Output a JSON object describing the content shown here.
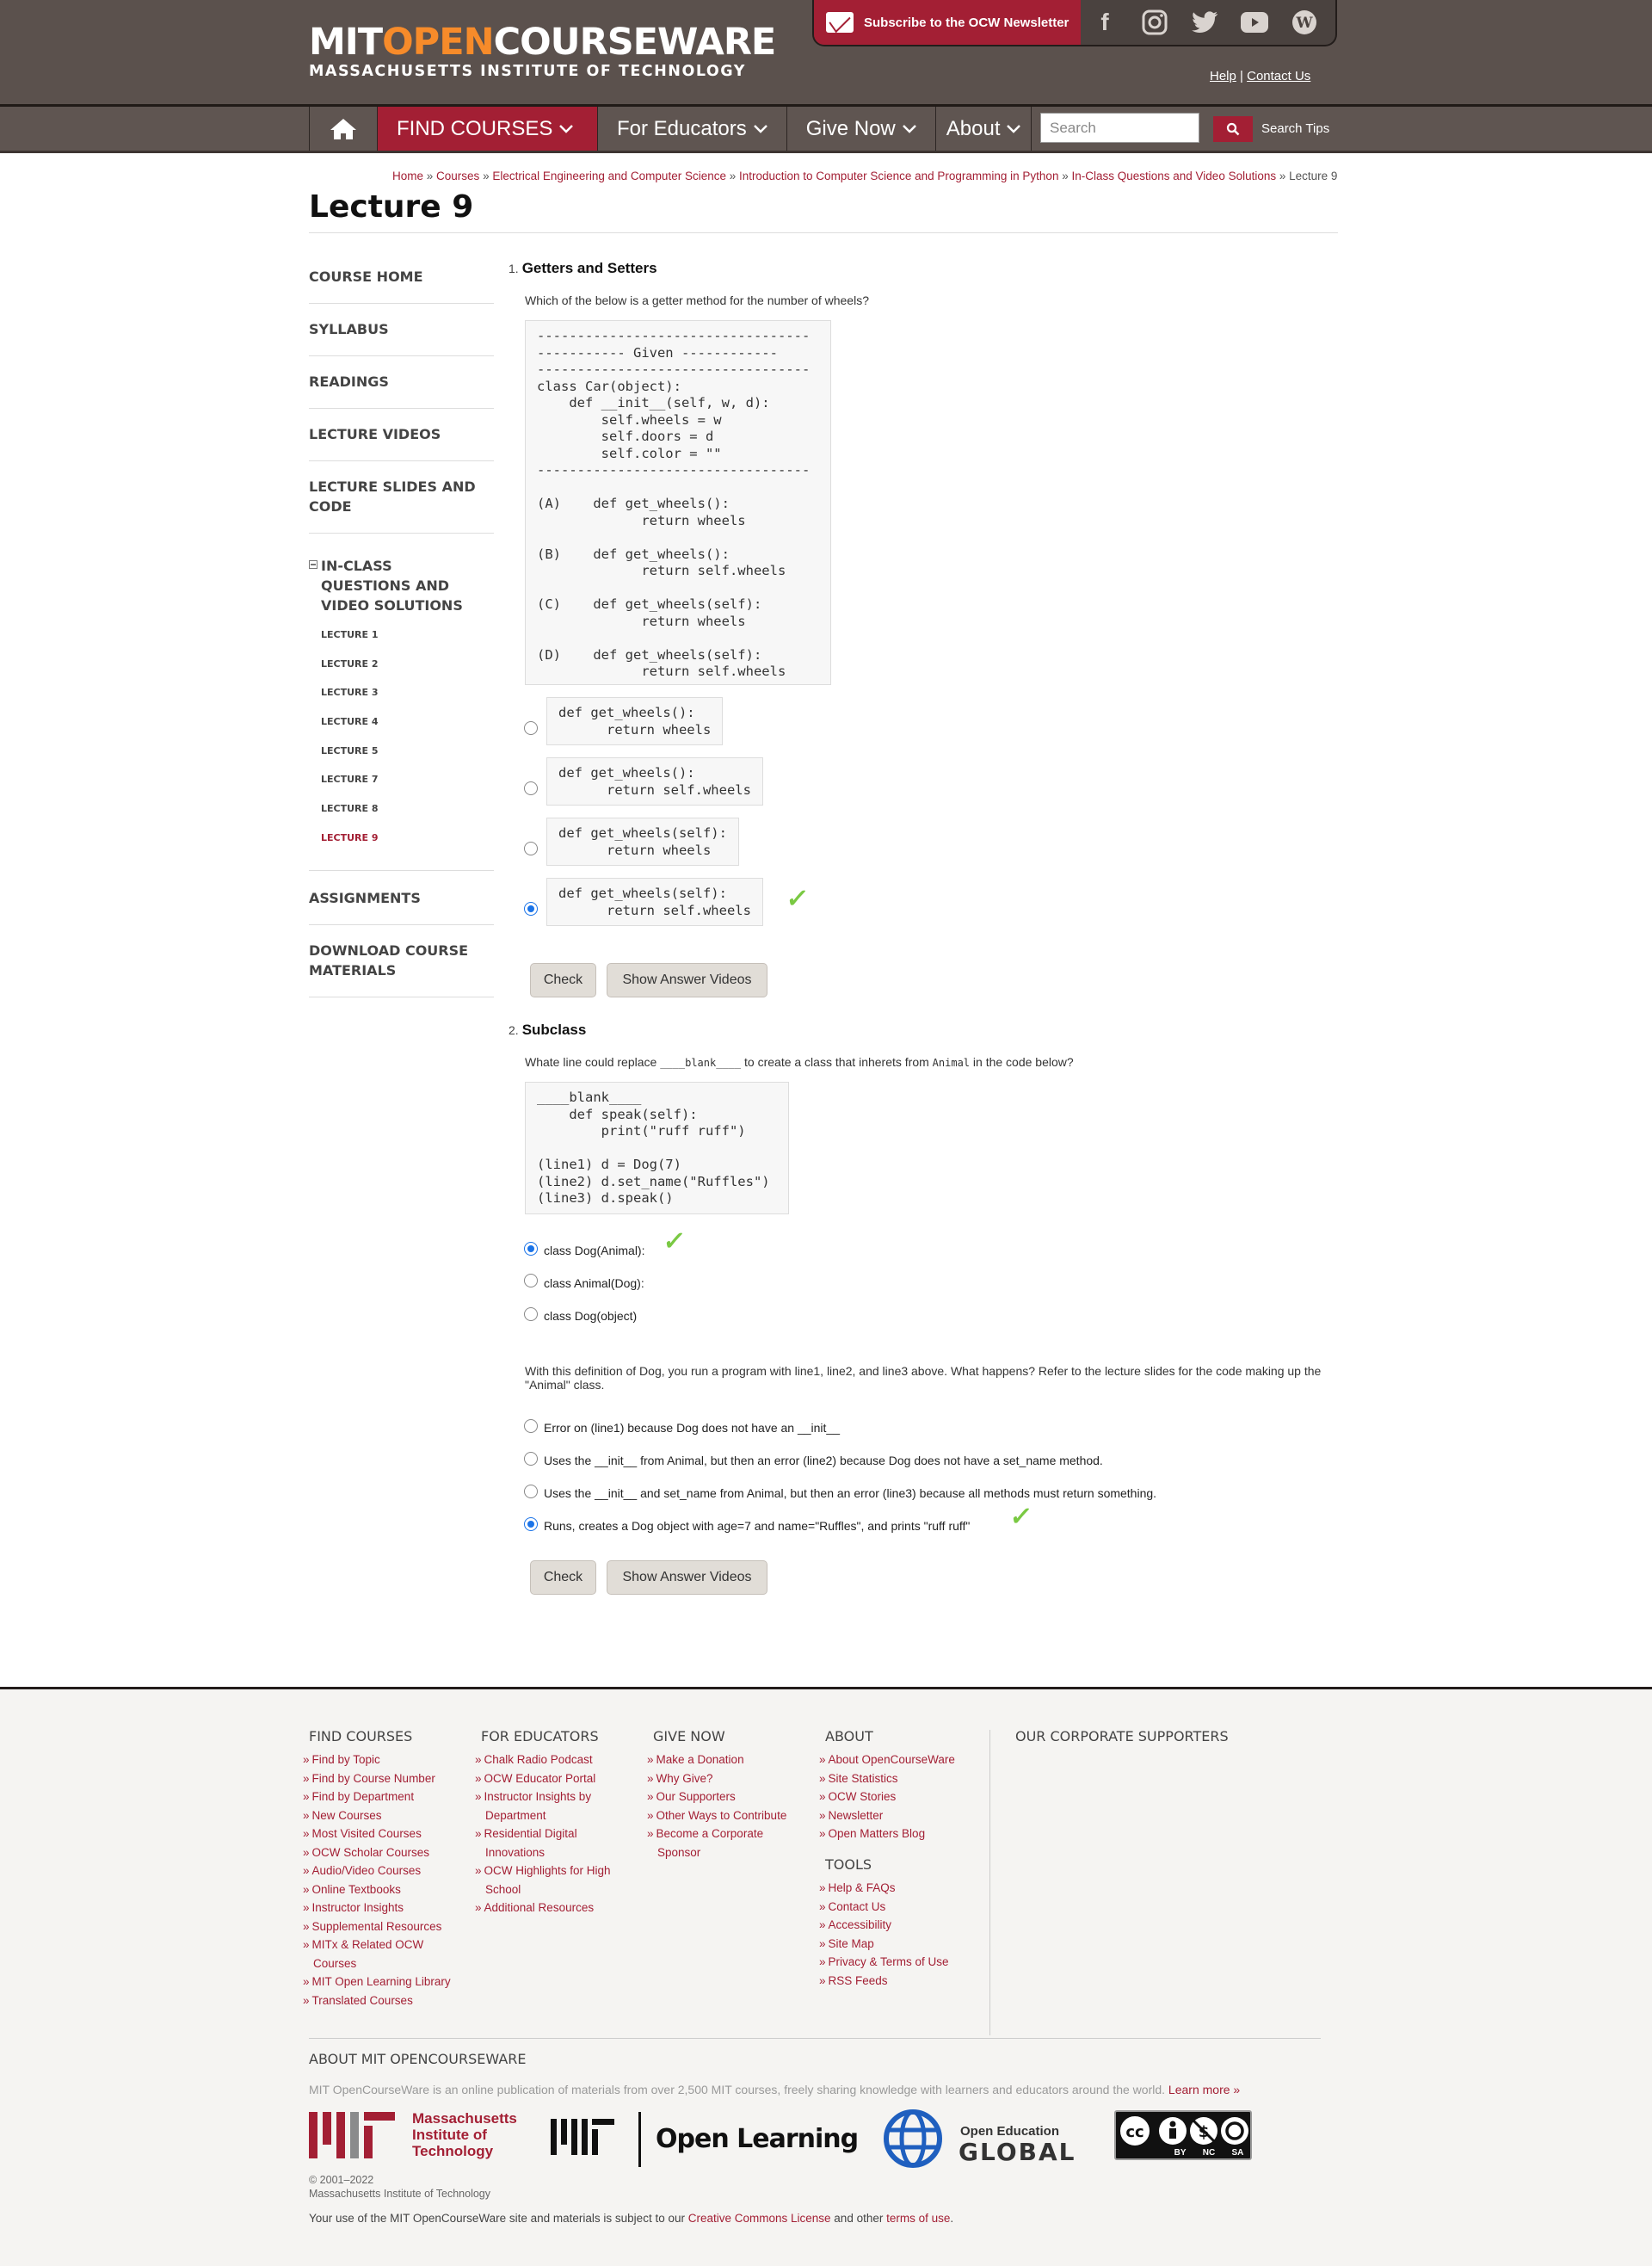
{
  "header": {
    "logo_mit": "MIT",
    "logo_open": "OPEN",
    "logo_cw": "COURSEWARE",
    "logo_sub": "MASSACHUSETTS INSTITUTE OF TECHNOLOGY",
    "newsletter": "Subscribe to the OCW Newsletter",
    "help": "Help",
    "separator": "|",
    "contact": "Contact Us"
  },
  "nav": {
    "find_courses": "FIND COURSES",
    "for_educators": "For Educators",
    "give_now": "Give Now",
    "about": "About",
    "search_placeholder": "Search",
    "search_tips": "Search Tips"
  },
  "breadcrumb": {
    "items": [
      "Home",
      "Courses",
      "Electrical Engineering and Computer Science",
      "Introduction to Computer Science and Programming in Python",
      "In-Class Questions and Video Solutions"
    ],
    "sep": " » ",
    "current": "Lecture 9"
  },
  "page_title": "Lecture 9",
  "sidebar": {
    "course_home": "COURSE HOME",
    "syllabus": "SYLLABUS",
    "readings": "READINGS",
    "lecture_videos": "LECTURE VIDEOS",
    "lecture_slides_1": "LECTURE SLIDES AND",
    "lecture_slides_2": "CODE",
    "inclass_1": "IN-CLASS",
    "inclass_2": "QUESTIONS AND",
    "inclass_3": "VIDEO SOLUTIONS",
    "lectures": [
      "LECTURE 1",
      "LECTURE 2",
      "LECTURE 3",
      "LECTURE 4",
      "LECTURE 5",
      "LECTURE 7",
      "LECTURE 8",
      "LECTURE 9"
    ],
    "assignments": "ASSIGNMENTS",
    "download_1": "DOWNLOAD COURSE",
    "download_2": "MATERIALS"
  },
  "q1": {
    "num": "1.",
    "title": "Getters and Setters",
    "prompt": "Which of the below is a getter method for the number of wheels?",
    "code": "----------------------------------\n----------- Given ------------\n----------------------------------\nclass Car(object):\n    def __init__(self, w, d):\n        self.wheels = w\n        self.doors = d\n        self.color = \"\"\n----------------------------------\n\n(A)    def get_wheels():\n             return wheels\n\n(B)    def get_wheels():\n             return self.wheels\n\n(C)    def get_wheels(self):\n             return wheels\n\n(D)    def get_wheels(self):\n             return self.wheels",
    "options": [
      "def get_wheels():\n      return wheels",
      "def get_wheels():\n      return self.wheels",
      "def get_wheels(self):\n      return wheels",
      "def get_wheels(self):\n      return self.wheels"
    ],
    "selected_index": 3,
    "check": "Check",
    "show_videos": "Show Answer Videos"
  },
  "q2": {
    "num": "2.",
    "title": "Subclass",
    "prompt_a": "Whate line could replace ",
    "prompt_blank": "____blank____",
    "prompt_b": " to create a class that inherets from ",
    "prompt_animal": "Animal",
    "prompt_c": " in the code below?",
    "code": "____blank____\n    def speak(self):\n        print(\"ruff ruff\")\n\n(line1) d = Dog(7)\n(line2) d.set_name(\"Ruffles\")\n(line3) d.speak()",
    "options": [
      "class Dog(Animal):",
      "class Animal(Dog):",
      "class Dog(object)"
    ],
    "selected_index": 0,
    "prompt2": "With this definition of Dog, you run a program with line1, line2, and line3 above. What happens? Refer to the lecture slides for the code making up the \"Animal\" class.",
    "options2": [
      "Error on (line1) because Dog does not have an __init__",
      "Uses the __init__ from Animal, but then an error (line2) because Dog does not have a set_name method.",
      "Uses the __init__ and set_name from Animal, but then an error (line3) because all methods must return something.",
      "Runs, creates a Dog object with age=7 and name=\"Ruffles\", and prints \"ruff ruff\""
    ],
    "selected_index2": 3,
    "check": "Check",
    "show_videos": "Show Answer Videos"
  },
  "footer": {
    "find_courses": {
      "title": "FIND COURSES",
      "items": [
        "Find by Topic",
        "Find by Course Number",
        "Find by Department",
        "New Courses",
        "Most Visited Courses",
        "OCW Scholar Courses",
        "Audio/Video Courses",
        "Online Textbooks",
        "Instructor Insights",
        "Supplemental Resources",
        "MITx & Related OCW Courses",
        "MIT Open Learning Library",
        "Translated Courses"
      ]
    },
    "for_educators": {
      "title": "FOR EDUCATORS",
      "items": [
        "Chalk Radio Podcast",
        "OCW Educator Portal",
        "Instructor Insights by Department",
        "Residential Digital Innovations",
        "OCW Highlights for High School",
        "Additional Resources"
      ]
    },
    "give_now": {
      "title": "GIVE NOW",
      "items": [
        "Make a Donation",
        "Why Give?",
        "Our Supporters",
        "Other Ways to Contribute",
        "Become a Corporate Sponsor"
      ]
    },
    "about": {
      "title": "ABOUT",
      "items": [
        "About OpenCourseWare",
        "Site Statistics",
        "OCW Stories",
        "Newsletter",
        "Open Matters Blog"
      ]
    },
    "tools": {
      "title": "TOOLS",
      "items": [
        "Help & FAQs",
        "Contact Us",
        "Accessibility",
        "Site Map",
        "Privacy & Terms of Use",
        "RSS Feeds"
      ]
    },
    "supporters_title": "OUR CORPORATE SUPPORTERS",
    "about_title": "ABOUT MIT OPENCOURSEWARE",
    "about_text": "MIT OpenCourseWare is an online publication of materials from over 2,500 MIT courses, freely sharing knowledge with learners and educators around the world.",
    "learn_more": "Learn more »",
    "logo_mit_1": "Massachusetts",
    "logo_mit_2": "Institute of",
    "logo_mit_3": "Technology",
    "logo_open_learning": "Open Learning",
    "logo_oeg_1": "Open Education",
    "logo_oeg_2": "GLOBAL",
    "cc_by": "BY",
    "cc_nc": "NC",
    "cc_sa": "SA",
    "copyright_1": "© 2001–2022",
    "copyright_2": "Massachusetts Institute of Technology",
    "terms_a": "Your use of the MIT OpenCourseWare site and materials is subject to our ",
    "terms_cc": "Creative Commons License",
    "terms_b": " and other ",
    "terms_tou": "terms of use",
    "terms_c": "."
  }
}
